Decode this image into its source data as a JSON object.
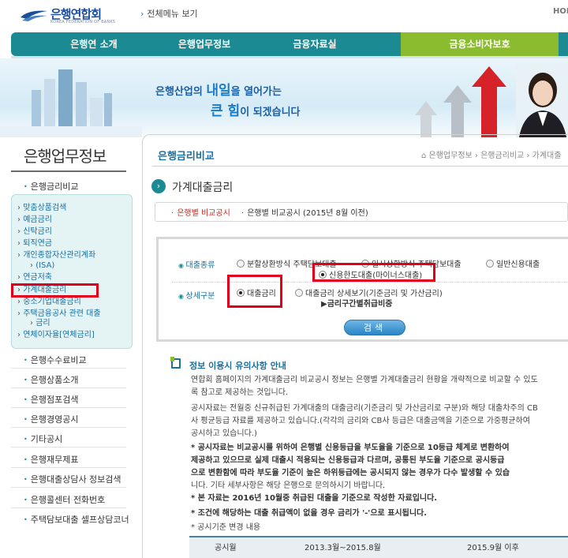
{
  "header": {
    "logo_text": "은행연합회",
    "logo_sub": "KOREA FEDERATION OF BANKS",
    "all_menu": "전체메뉴 보기",
    "home": "HOM"
  },
  "gnb": {
    "items": [
      {
        "label": "은행연 소개"
      },
      {
        "label": "은행업무정보"
      },
      {
        "label": "금융자료실"
      },
      {
        "label": "금융소비자보호"
      }
    ]
  },
  "banner": {
    "line1_pre": "은행산업의 ",
    "line1_big": "내일",
    "line1_post": "을 열어가는",
    "line2_big": "큰 힘",
    "line2_post": "이 되겠습니다"
  },
  "sidebar": {
    "title": "은행업무정보",
    "top_item": "은행금리비교",
    "sub_items": [
      "맞춤상품검색",
      "예금금리",
      "신탁금리",
      "퇴직연금",
      "개인종합자산관리계좌",
      "(ISA)",
      "연금저축",
      "가계대출금리",
      "중소기업대출금리",
      "주택금융공사 관련 대출",
      "금리",
      "연체이자율[연체금리]"
    ],
    "items": [
      "은행수수료비교",
      "은행상품소개",
      "은행점포검색",
      "은행경영공시",
      "기타공시",
      "은행재무제표",
      "은행대출상담사 정보검색",
      "은행콜센터 전화번호",
      "주택담보대출 셀프상담코너"
    ]
  },
  "content": {
    "heading": "은행금리비교",
    "breadcrumb": "은행업무정보 › 은행금리비교 › 가계대출",
    "section_title": "가계대출금리",
    "tabs": [
      {
        "label": "은행별 비교공시",
        "active": true
      },
      {
        "label": "은행별 비교공시 (2015년 8월 이전)",
        "active": false
      }
    ]
  },
  "form": {
    "label_type": "대출종류",
    "label_detail": "상세구분",
    "types": [
      {
        "label": "분할상환방식 주택담보대출",
        "selected": false
      },
      {
        "label": "일시상환방식 주택담보대출",
        "selected": false
      },
      {
        "label": "일반신용대출",
        "selected": false
      },
      {
        "label": "신용한도대출(마이너스대출)",
        "selected": true
      }
    ],
    "details": [
      {
        "label": "대출금리",
        "selected": true
      },
      {
        "label": "대출금리 상세보기(기준금리 및 가산금리)",
        "selected": false
      }
    ],
    "grade_link": "▶금리구간별취급비중",
    "search_label": "검색"
  },
  "notice": {
    "title": "정보 이용시 유의사항 안내",
    "paragraphs": [
      "연합회 홈페이지의 가계대출금리 비교공시 정보는 은행별 가계대출금리 현황을 개략적으로 비교할 수 있도",
      "록 참고로 제공하는 것입니다.",
      "공시자료는 전월중 신규취급된 가계대출의 대출금리(기준금리 및 가산금리로 구분)와 해당 대출차주의 CB",
      "사 평균등급 자료를 제공하고 있습니다.(각각의 금리와 CB사 등급은 대출금액을 기준으로 가중평균하여",
      "공시하고 있습니다.)",
      "* 공시자료는 비교공시를 위하여 은행별 신용등급을 부도율을 기준으로 10등급 체계로 변환하여",
      "제공하고 있으므로 실제 대출시 적용되는 신용등급과 다르며, 공통된 부도율 기준으로 공시등급",
      "으로 변환함에 따라 부도율 기준이 높은 하위등급에는 공시되지 않는 경우가 다수 발생할 수 있습",
      "니다. 기타 세부사항은 해당 은행으로 문의하시기 바랍니다.",
      "* 본 자료는 2016년 10월중 취급된 대출을 기준으로 작성한 자료입니다.",
      "* 조건에 해당하는 대출 취급액이 없을 경우 금리가 '-'으로 표시됩니다.",
      "* 공시기준 변경 내용"
    ]
  },
  "table": {
    "headers": [
      "공시월",
      "2013.3월~2015.8월",
      "2015.9월 이후"
    ]
  },
  "colors": {
    "brand_teal": "#1b8a93",
    "brand_green": "#8bbc2f",
    "highlight_red": "#e0001b",
    "link_blue": "#1b6fa0"
  }
}
